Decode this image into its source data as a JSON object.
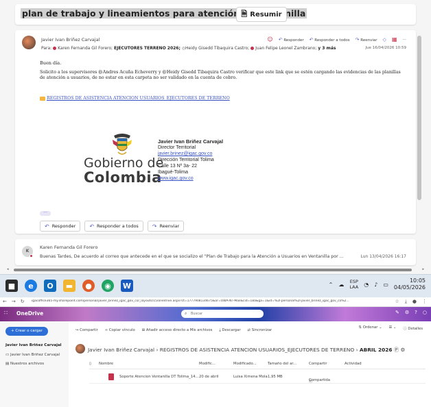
{
  "outlook": {
    "subject": "plan de trabajo y lineamientos para atención en ventanilla",
    "summarize_label": "Resumir",
    "message1": {
      "sender": "Javier Ivan Briñez Carvajal",
      "to_label": "Para:",
      "recipients": [
        "Karen Fernanda Gil Forero;",
        "EJECUTORES TERRENO 2026;",
        "Heidy Gisedd Tibaquira Castro;",
        "Juan Felipe Leonel Zambrano;"
      ],
      "more": "y 3 más",
      "actions": {
        "reply": "Responder",
        "reply_all": "Responder a todos",
        "forward": "Reenviar"
      },
      "date": "Jue 16/04/2026 10:59",
      "greeting": "Buen día.",
      "body": "Solicito a los supervisores @Andres Acuña Echeverry y @Heidy Gisedd Tibaquira Castro verificar que este link que se estén cargando las evidencias de las planillas de atención a usuarios, de no estar en esta carpeta no ser validado en la cuenta de cobro.",
      "folder_link": "REGISTROS DE ASISTENCIA ATENCION USUARIOS_EJECUTORES DE TERRENO",
      "signature": {
        "logo_line1": "Gobierno de",
        "logo_line2": "Colombia",
        "name": "Javier Ivan Briñez Carvajal",
        "role": "Director Territorial",
        "email": "javier.brinez@igac.gov.co",
        "office": "Dirección Territorial Tolima",
        "address": "Calle 13 Nº 3a- 22",
        "city": "Ibagué-Tolima",
        "web": "www.igac.gov.co"
      },
      "ellipsis": "···",
      "buttons": {
        "reply": "Responder",
        "reply_all": "Responder a todos",
        "forward": "Reenviar"
      }
    },
    "message2": {
      "avatar_initial": "K",
      "sender": "Karen Fernanda Gil Forero",
      "preview": "Buenas Tardes, De acuerdo al correo que antecede en el que se socializo el \"Plan de Trabajo para la Atención a Usuarios en Ventanilla por ...",
      "date": "Lun 13/04/2026 16:17"
    }
  },
  "taskbar": {
    "lang_top": "ESP",
    "lang_bottom": "LAA",
    "time": "10:05",
    "date": "04/05/2026"
  },
  "browser": {
    "url": "igacoffice365-my.sharepoint.com/personal/javier_brinez_igac_gov_co/_layouts/15/onedrive.aspx?ct=1777908134675&or=OWA-NT-Mail&cid=18a&ga=1&id=%2Fpersonal%2Fjavier_brinez_igac_gov_co%2..."
  },
  "onedrive": {
    "app_name": "OneDrive",
    "search_placeholder": "Buscar",
    "create_label": "+ Crear o cargar",
    "sidebar_user": "Javier Ivan Briñez Carvajal",
    "sidebar_items": [
      "Javier Ivan Briñez Carvajal",
      "Nuestros archivos"
    ],
    "commands": [
      "Compartir",
      "Copiar vínculo",
      "Añadir acceso directo a Mis archivos",
      "Descargar",
      "Sincronizar"
    ],
    "commands_right": [
      "Ordenar",
      "",
      "Detalles"
    ],
    "breadcrumb": [
      "Javier Ivan Briñez Carvajal",
      "REGISTROS DE ASISTENCIA ATENCION USUARIOS_EJECUTORES DE TERRENO"
    ],
    "breadcrumb_current": "ABRIL 2026",
    "columns": [
      "Nombre",
      "Modific...",
      "Modificado...",
      "Tamaño del ar...",
      "Compartir",
      "Actividad"
    ],
    "rows": [
      {
        "name": "Soporte Atencion Ventanilla DT Tolima_14...",
        "modified": "20 de abril",
        "modified_by": "Luisa Ximena Mola",
        "size": "1,95 MB",
        "sharing": "Compartida"
      }
    ]
  }
}
